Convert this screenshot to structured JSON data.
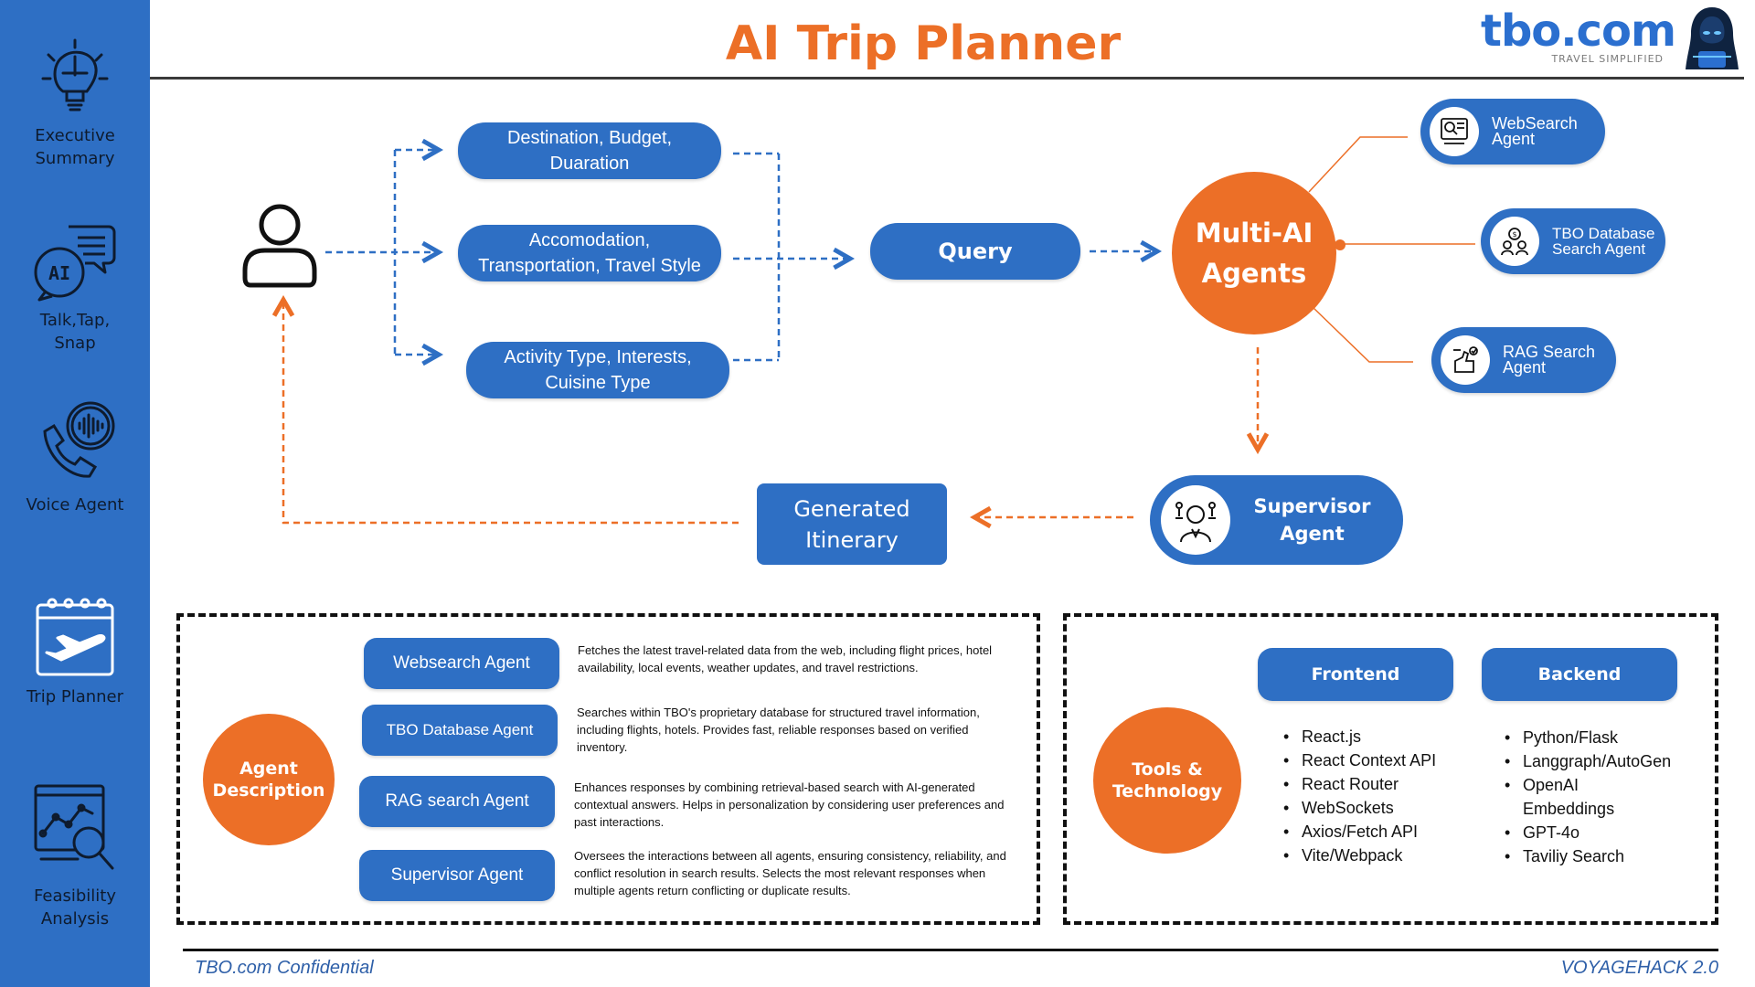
{
  "sidebar": {
    "items": [
      {
        "label": "Executive Summary",
        "icon": "brain-puzzle-icon"
      },
      {
        "label": "Talk,Tap, Snap",
        "icon": "ai-chat-bubble-icon"
      },
      {
        "label": "Voice Agent",
        "icon": "phone-voice-icon"
      },
      {
        "label": "Trip Planner",
        "icon": "calendar-plane-icon"
      },
      {
        "label": "Feasibility Analysis",
        "icon": "analytics-magnifier-icon"
      }
    ]
  },
  "header": {
    "title": "AI Trip Planner",
    "logo_text": "tbo.com",
    "logo_tagline": "TRAVEL SIMPLIFIED"
  },
  "flow": {
    "inputs": [
      "Destination, Budget, Duaration",
      "Accomodation, Transportation, Travel Style",
      "Activity Type, Interests, Cuisine Type"
    ],
    "query": "Query",
    "multi_ai": "Multi-AI Agents",
    "agents": [
      {
        "label": "WebSearch Agent",
        "icon": "web-search-icon"
      },
      {
        "label": "TBO Database Search Agent",
        "icon": "database-money-icon"
      },
      {
        "label": "RAG Search Agent",
        "icon": "rag-hand-icon"
      }
    ],
    "supervisor": "Supervisor Agent",
    "itinerary": "Generated Itinerary"
  },
  "agent_description": {
    "title": "Agent Description",
    "items": [
      {
        "name": "Websearch Agent",
        "text": "Fetches the latest travel-related data from the web, including flight prices, hotel availability, local events, weather updates, and travel restrictions."
      },
      {
        "name": "TBO Database Agent",
        "text": "Searches within TBO's proprietary database for structured travel information, including flights, hotels. Provides fast, reliable responses based on verified inventory."
      },
      {
        "name": "RAG search Agent",
        "text": "Enhances responses by combining retrieval-based search with AI-generated contextual answers. Helps in personalization by considering user preferences and past interactions."
      },
      {
        "name": "Supervisor Agent",
        "text": "Oversees the interactions between all agents, ensuring consistency, reliability, and conflict resolution in search results. Selects the most relevant responses when multiple agents return conflicting or duplicate results."
      }
    ]
  },
  "tools": {
    "title": "Tools & Technology",
    "frontend_title": "Frontend",
    "frontend": [
      "React.js",
      "React Context API",
      "React Router",
      "WebSockets",
      "Axios/Fetch API",
      "Vite/Webpack"
    ],
    "backend_title": "Backend",
    "backend": [
      "Python/Flask",
      "Langgraph/AutoGen",
      "OpenAI Embeddings",
      "GPT-4o",
      "Taviliy Search"
    ]
  },
  "footer": {
    "left": "TBO.com Confidential",
    "right": "VOYAGEHACK 2.0"
  },
  "colors": {
    "blue": "#2e6fc4",
    "orange": "#ec6f27",
    "brand_blue": "#2b6fcf",
    "footer_text": "#2e5fa8"
  }
}
